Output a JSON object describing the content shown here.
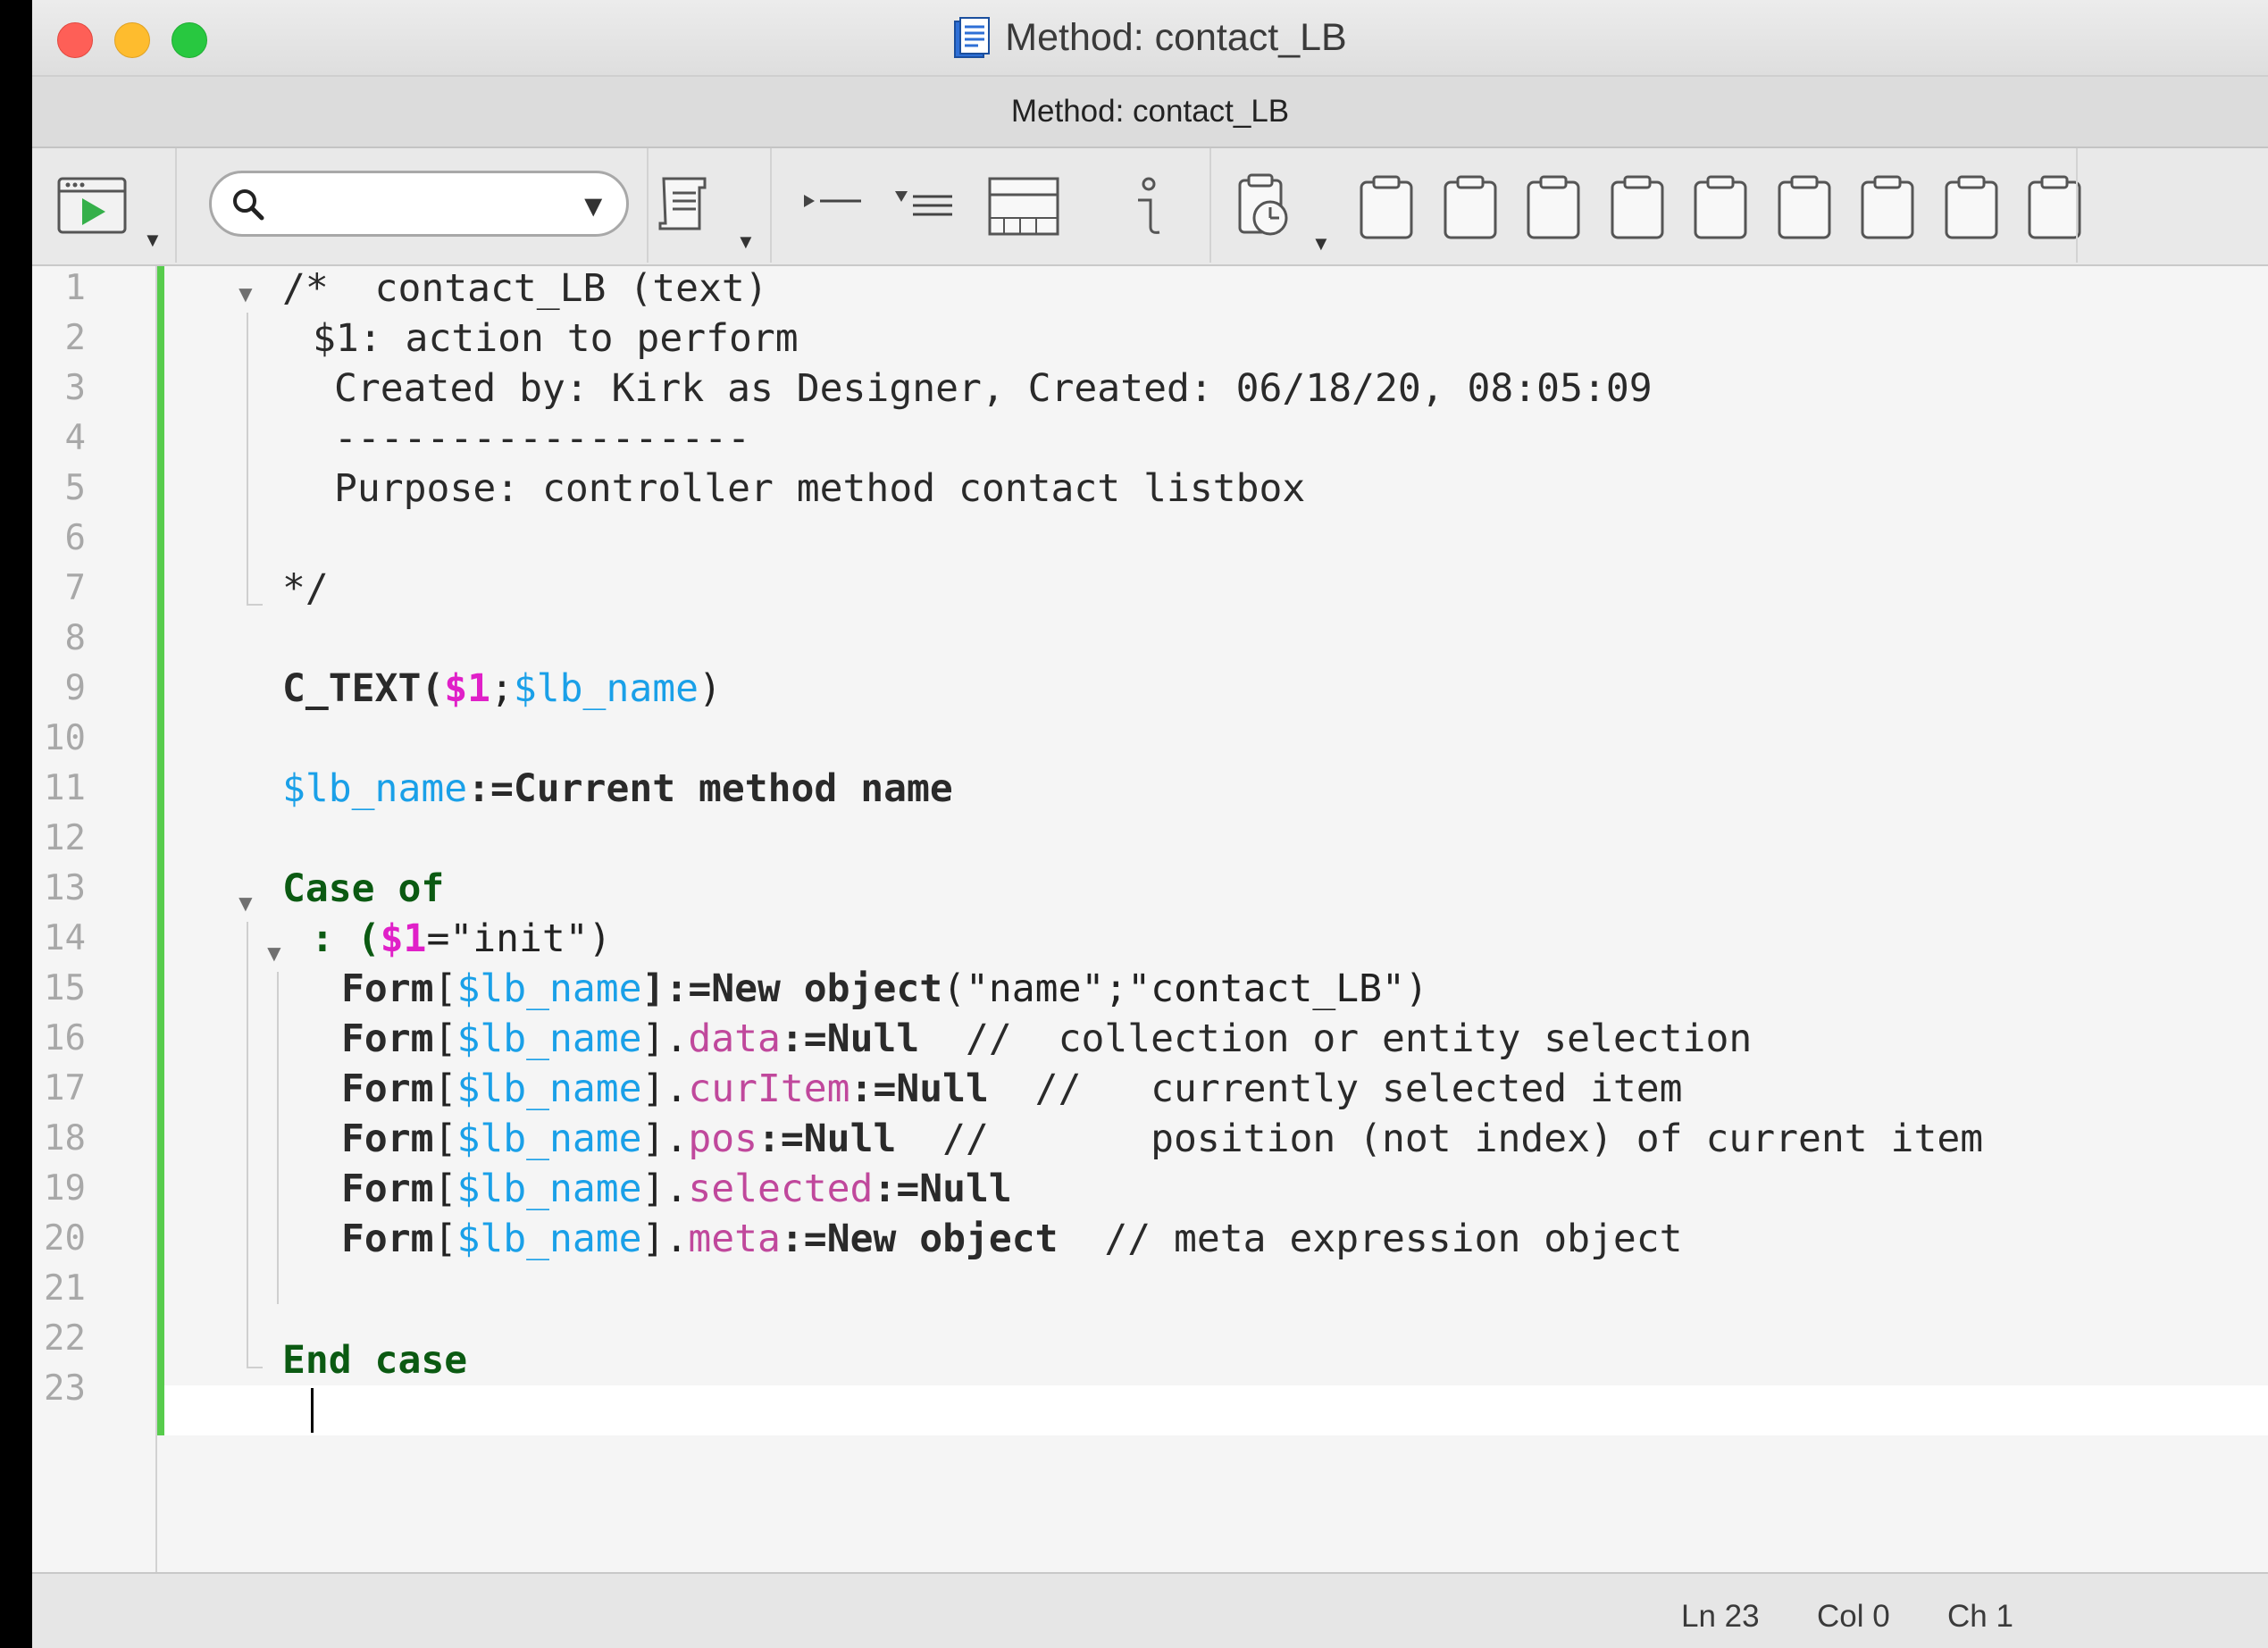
{
  "window": {
    "title": "Method: contact_LB",
    "tab_title": "Method: contact_LB"
  },
  "toolbar": {
    "search_placeholder": "",
    "icons": [
      "run-icon",
      "search-icon",
      "method-list-icon",
      "collapse-icon",
      "expand-icon",
      "form-icon",
      "info-icon",
      "clipboard-history-icon",
      "clipboard-1",
      "clipboard-2",
      "clipboard-3",
      "clipboard-4",
      "clipboard-5",
      "clipboard-6",
      "clipboard-7",
      "clipboard-8",
      "clipboard-9"
    ]
  },
  "editor": {
    "line_numbers": [
      "1",
      "2",
      "3",
      "4",
      "5",
      "6",
      "7",
      "8",
      "9",
      "10",
      "11",
      "12",
      "13",
      "14",
      "15",
      "16",
      "17",
      "18",
      "19",
      "20",
      "21",
      "22",
      "23"
    ],
    "lines": {
      "l1": {
        "text": "/*  contact_LB (text)"
      },
      "l2": {
        "text": "$1: action to perform"
      },
      "l3": {
        "text": "Created by: Kirk as Designer, Created: 06/18/20, 08:05:09"
      },
      "l4": {
        "text": "------------------"
      },
      "l5": {
        "text": "Purpose: controller method contact listbox"
      },
      "l7": {
        "text": "*/"
      },
      "l9": {
        "a": "C_TEXT(",
        "b": "$1",
        "c": ";",
        "d": "$lb_name",
        "e": ")"
      },
      "l11": {
        "a": "$lb_name",
        "b": ":=",
        "c": "Current method name"
      },
      "l13": {
        "a": "Case of"
      },
      "l14": {
        "a": ": (",
        "b": "$1",
        "c": "=\"init\")"
      },
      "l15": {
        "a": "Form",
        "b": "[",
        "c": "$lb_name",
        "d": "]:=",
        "e": "New object",
        "f": "(\"name\";\"contact_LB\")"
      },
      "l16": {
        "a": "Form",
        "b": "[",
        "c": "$lb_name",
        "d": "].",
        "e": "data",
        "f": ":=",
        "g": "Null",
        "h": "  //  collection or entity selection"
      },
      "l17": {
        "a": "Form",
        "b": "[",
        "c": "$lb_name",
        "d": "].",
        "e": "curItem",
        "f": ":=",
        "g": "Null",
        "h": "  //   currently selected item"
      },
      "l18": {
        "a": "Form",
        "b": "[",
        "c": "$lb_name",
        "d": "].",
        "e": "pos",
        "f": ":=",
        "g": "Null",
        "h": "  //       position (not index) of current item"
      },
      "l19": {
        "a": "Form",
        "b": "[",
        "c": "$lb_name",
        "d": "].",
        "e": "selected",
        "f": ":=",
        "g": "Null"
      },
      "l20": {
        "a": "Form",
        "b": "[",
        "c": "$lb_name",
        "d": "].",
        "e": "meta",
        "f": ":=",
        "g": "New object",
        "h": "  // meta expression object"
      },
      "l22": {
        "a": "End case"
      }
    }
  },
  "status": {
    "line": "Ln 23",
    "col": "Col 0",
    "ch": "Ch 1"
  },
  "colors": {
    "variable": "#1aa0e8",
    "parameter": "#e020c8",
    "keyword": "#0b5a12",
    "property": "#c0489c",
    "modified_bar": "#57cc4c"
  }
}
